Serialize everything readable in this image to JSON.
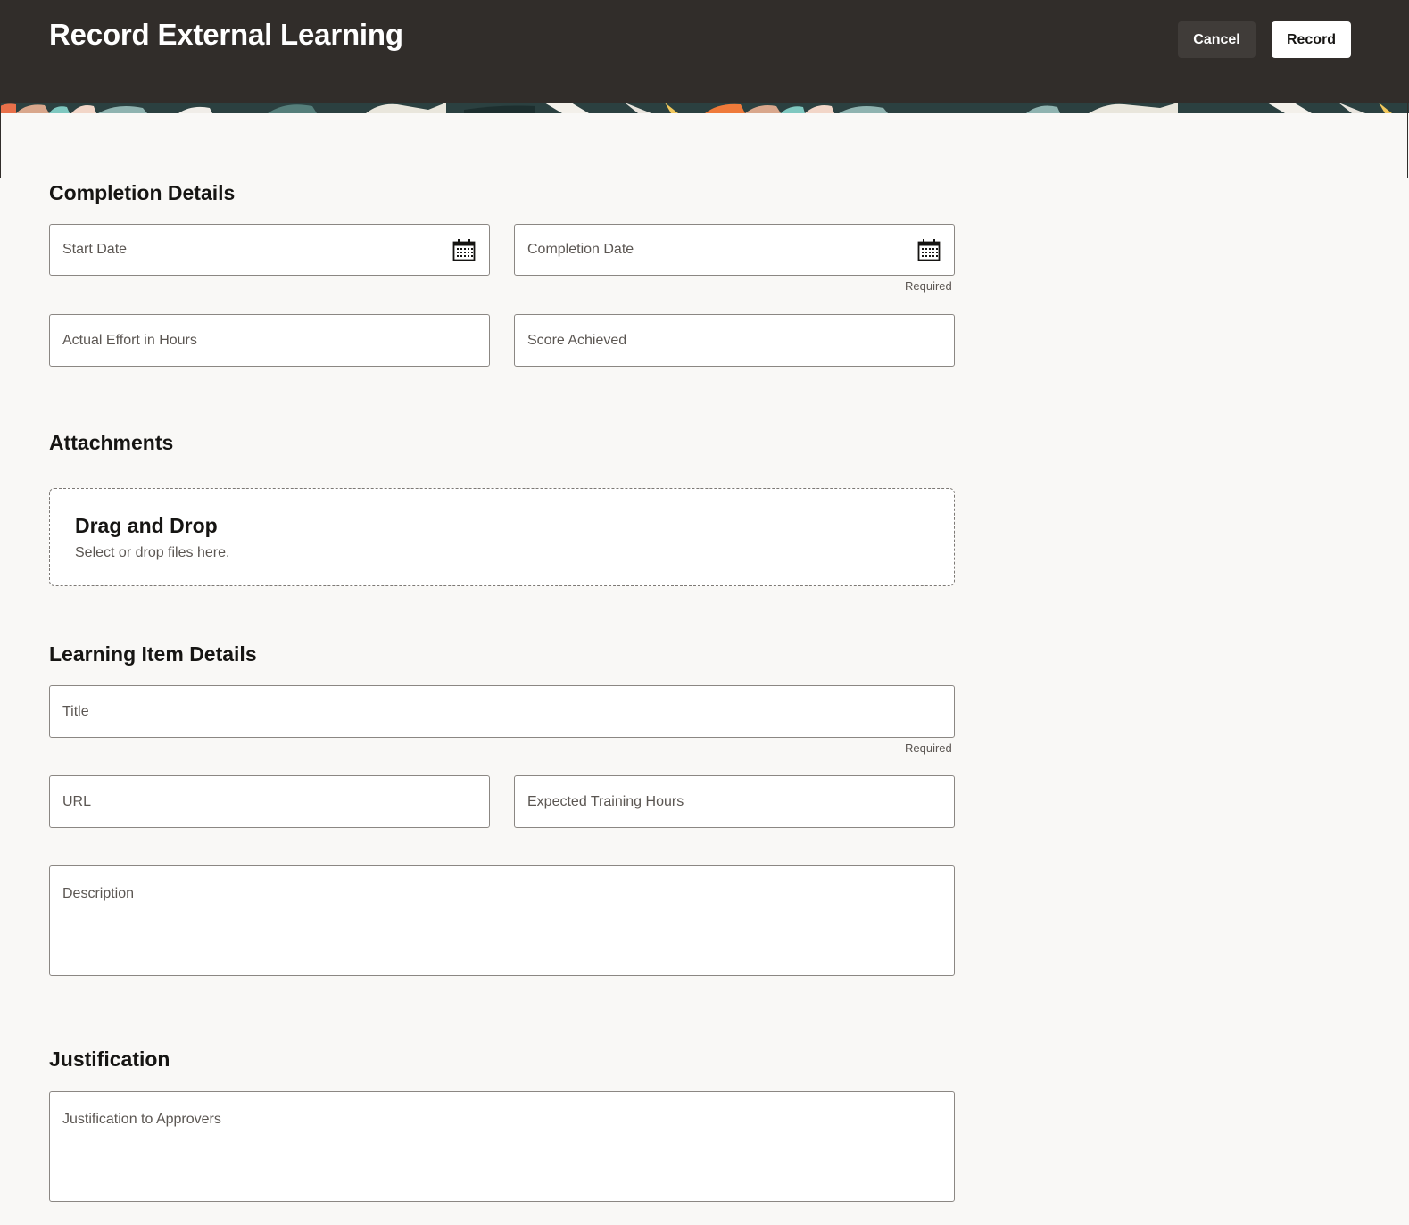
{
  "header": {
    "title": "Record External Learning",
    "cancel_label": "Cancel",
    "record_label": "Record"
  },
  "completion": {
    "title": "Completion Details",
    "start_date_label": "Start Date",
    "completion_date_label": "Completion Date",
    "completion_required": "Required",
    "effort_label": "Actual Effort in Hours",
    "score_label": "Score Achieved",
    "calendar_icon": "calendar-icon"
  },
  "attachments": {
    "title": "Attachments",
    "drop_title": "Drag and Drop",
    "drop_hint": "Select or drop files here."
  },
  "learning_item": {
    "title": "Learning Item Details",
    "title_label": "Title",
    "title_required": "Required",
    "url_label": "URL",
    "expected_hours_label": "Expected Training Hours",
    "description_label": "Description"
  },
  "justification": {
    "title": "Justification",
    "approvers_label": "Justification to Approvers"
  },
  "colors": {
    "header_bg": "#312d2a",
    "page_bg": "#f9f8f6",
    "field_border": "#8b8783"
  }
}
